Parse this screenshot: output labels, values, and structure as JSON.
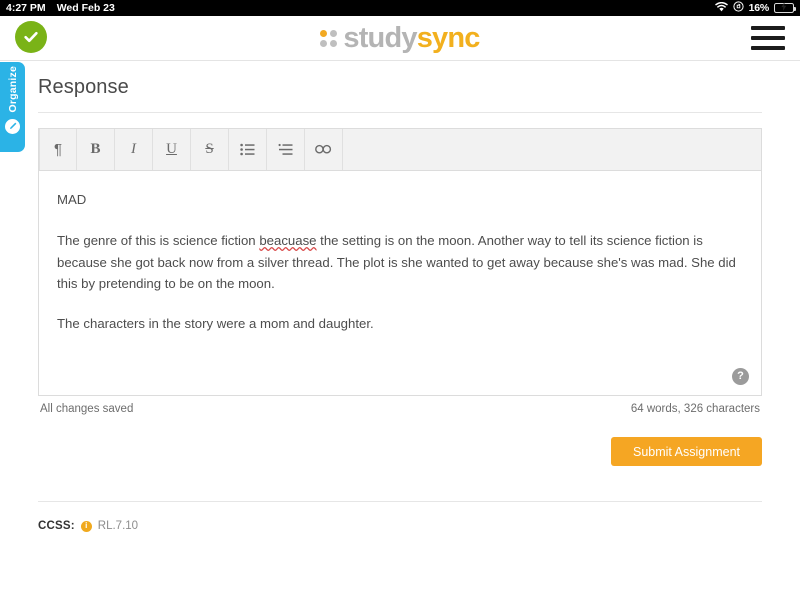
{
  "statusbar": {
    "time": "4:27 PM",
    "date": "Wed Feb 23",
    "wifi_icon": "wifi-icon",
    "lock_icon": "rotation-lock-icon",
    "battery_percent": "16%",
    "battery_icon": "battery-charging-icon"
  },
  "header": {
    "logo_primary": "study",
    "logo_accent": "sync",
    "logo_icon": "studysync-dots-logo",
    "menu_icon": "hamburger-menu-icon"
  },
  "rail": {
    "status_icon": "check-circle-icon",
    "organize_label": "Organize",
    "organize_icon": "pencil-circle-icon"
  },
  "page": {
    "title": "Response"
  },
  "toolbar": {
    "buttons": [
      {
        "label": "¶",
        "name": "paragraph-format-button"
      },
      {
        "label": "B",
        "name": "bold-button"
      },
      {
        "label": "I",
        "name": "italic-button"
      },
      {
        "label": "U",
        "name": "underline-button"
      },
      {
        "label": "S",
        "name": "strikethrough-button"
      },
      {
        "label": "",
        "name": "bulleted-list-button"
      },
      {
        "label": "",
        "name": "numbered-list-button"
      },
      {
        "label": "",
        "name": "insert-link-button"
      }
    ]
  },
  "editor": {
    "heading": "MAD",
    "paragraph_1_a": "The genre of this is science fiction ",
    "paragraph_1_misspelled": "beacuase",
    "paragraph_1_b": " the setting is on the moon. Another way to tell its science fiction is because she got back now from a silver thread. The plot is she wanted to get away because she's was mad. She did this by pretending to be on the moon.",
    "paragraph_2": "The characters in the story were a mom and daughter.",
    "help_label": "?"
  },
  "status": {
    "saved_text": "All changes saved",
    "word_count": "64 words, 326 characters"
  },
  "actions": {
    "submit_label": "Submit Assignment"
  },
  "footer": {
    "ccss_label": "CCSS:",
    "ccss_badge": "i",
    "ccss_code": "RL.7.10"
  },
  "colors": {
    "accent_orange": "#f5a623",
    "logo_yellow": "#f2b01e",
    "organize_blue": "#2bb3e6",
    "check_green": "#7ab317",
    "battery_yellow": "#f5c518"
  }
}
